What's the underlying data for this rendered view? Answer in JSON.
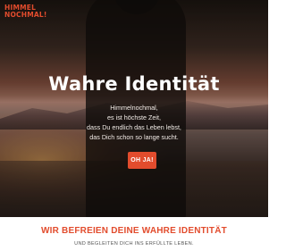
{
  "logo": {
    "line1": "HIMMEL",
    "line2": "NOCHMAL!"
  },
  "hero": {
    "title": "Wahre Identität",
    "lines": [
      "Himmelnochmal,",
      "es ist höchste Zeit,",
      "dass Du endlich das Leben lebst,",
      "das Dich schon so lange sucht."
    ],
    "cta_label": "OH JA!"
  },
  "section": {
    "title": "WIR BEFREIEN DEINE WAHRE IDENTITÄT",
    "subtitle": "UND BEGLEITEN DICH INS ERFÜLLTE LEBEN."
  },
  "colors": {
    "accent": "#e24c2d",
    "text_light": "#ffffff",
    "subtitle_gray": "#555555"
  }
}
